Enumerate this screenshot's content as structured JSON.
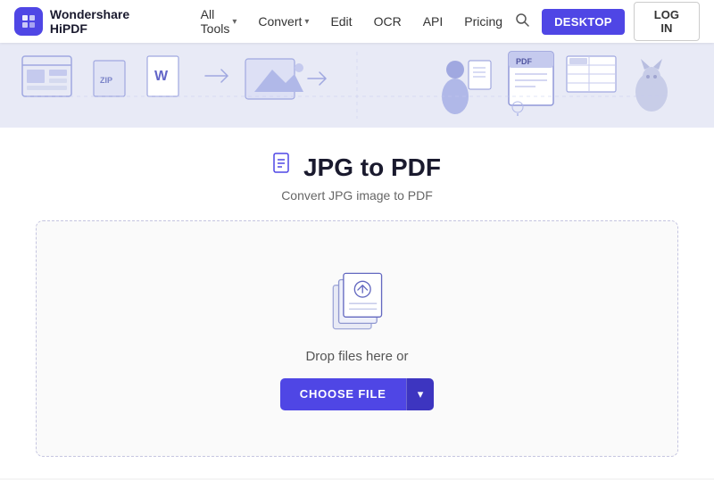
{
  "navbar": {
    "logo_text": "Wondershare HiPDF",
    "logo_icon": "W",
    "menu_items": [
      {
        "label": "All Tools",
        "has_dropdown": true
      },
      {
        "label": "Convert",
        "has_dropdown": true
      },
      {
        "label": "Edit",
        "has_dropdown": false
      },
      {
        "label": "OCR",
        "has_dropdown": false
      },
      {
        "label": "API",
        "has_dropdown": false
      },
      {
        "label": "Pricing",
        "has_dropdown": false
      }
    ],
    "btn_desktop": "DESKTOP",
    "btn_login": "LOG IN"
  },
  "page": {
    "title": "JPG to PDF",
    "subtitle": "Convert JPG image to PDF",
    "drop_text": "Drop files here or",
    "choose_label": "CHOOSE FILE",
    "arrow": "▾"
  },
  "colors": {
    "primary": "#4f46e5",
    "primary_dark": "#3d35c0"
  }
}
